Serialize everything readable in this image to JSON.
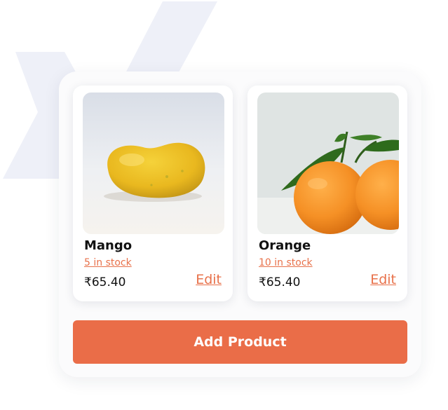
{
  "products": [
    {
      "name": "Mango",
      "stock_label": "5 in stock",
      "price": "₹65.40",
      "edit_label": "Edit"
    },
    {
      "name": "Orange",
      "stock_label": "10 in stock",
      "price": "₹65.40",
      "edit_label": "Edit"
    }
  ],
  "actions": {
    "add_product_label": "Add Product"
  },
  "colors": {
    "accent": "#ea6d48",
    "link": "#e8714a",
    "panel_bg": "#fbfbfc",
    "logo_tint": "#eef0f8"
  },
  "icons": {
    "background_logo": "x-logo-icon"
  }
}
